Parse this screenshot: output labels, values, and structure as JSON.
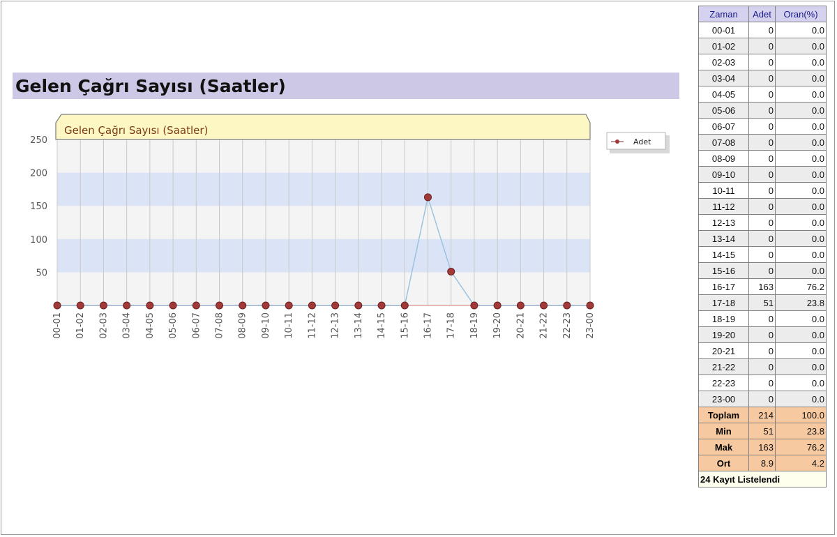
{
  "page_title": "Gelen Çağrı Sayısı (Saatler)",
  "chart_data": {
    "type": "line",
    "title": "Gelen Çağrı Sayısı (Saatler)",
    "xlabel": "",
    "ylabel": "",
    "ylim": [
      0,
      250
    ],
    "yticks": [
      50,
      100,
      150,
      200,
      250
    ],
    "categories": [
      "00-01",
      "01-02",
      "02-03",
      "03-04",
      "04-05",
      "05-06",
      "06-07",
      "07-08",
      "08-09",
      "09-10",
      "10-11",
      "11-12",
      "12-13",
      "13-14",
      "14-15",
      "15-16",
      "16-17",
      "17-18",
      "18-19",
      "19-20",
      "20-21",
      "21-22",
      "22-23",
      "23-00"
    ],
    "series": [
      {
        "name": "Adet",
        "values": [
          0,
          0,
          0,
          0,
          0,
          0,
          0,
          0,
          0,
          0,
          0,
          0,
          0,
          0,
          0,
          0,
          163,
          51,
          0,
          0,
          0,
          0,
          0,
          0
        ]
      }
    ],
    "grid": true,
    "legend": "right",
    "colors": {
      "line": "#9cc3dd",
      "marker": "#a23a3a",
      "band": "#dbe3f7",
      "title_bg": "#fdf7c4"
    }
  },
  "table": {
    "headers": [
      "Zaman",
      "Adet",
      "Oran(%)"
    ],
    "rows": [
      [
        "00-01",
        "0",
        "0.0"
      ],
      [
        "01-02",
        "0",
        "0.0"
      ],
      [
        "02-03",
        "0",
        "0.0"
      ],
      [
        "03-04",
        "0",
        "0.0"
      ],
      [
        "04-05",
        "0",
        "0.0"
      ],
      [
        "05-06",
        "0",
        "0.0"
      ],
      [
        "06-07",
        "0",
        "0.0"
      ],
      [
        "07-08",
        "0",
        "0.0"
      ],
      [
        "08-09",
        "0",
        "0.0"
      ],
      [
        "09-10",
        "0",
        "0.0"
      ],
      [
        "10-11",
        "0",
        "0.0"
      ],
      [
        "11-12",
        "0",
        "0.0"
      ],
      [
        "12-13",
        "0",
        "0.0"
      ],
      [
        "13-14",
        "0",
        "0.0"
      ],
      [
        "14-15",
        "0",
        "0.0"
      ],
      [
        "15-16",
        "0",
        "0.0"
      ],
      [
        "16-17",
        "163",
        "76.2"
      ],
      [
        "17-18",
        "51",
        "23.8"
      ],
      [
        "18-19",
        "0",
        "0.0"
      ],
      [
        "19-20",
        "0",
        "0.0"
      ],
      [
        "20-21",
        "0",
        "0.0"
      ],
      [
        "21-22",
        "0",
        "0.0"
      ],
      [
        "22-23",
        "0",
        "0.0"
      ],
      [
        "23-00",
        "0",
        "0.0"
      ]
    ],
    "stats": [
      [
        "Toplam",
        "214",
        "100.0"
      ],
      [
        "Min",
        "51",
        "23.8"
      ],
      [
        "Mak",
        "163",
        "76.2"
      ],
      [
        "Ort",
        "8.9",
        "4.2"
      ]
    ],
    "footer": "24 Kayıt Listelendi"
  }
}
